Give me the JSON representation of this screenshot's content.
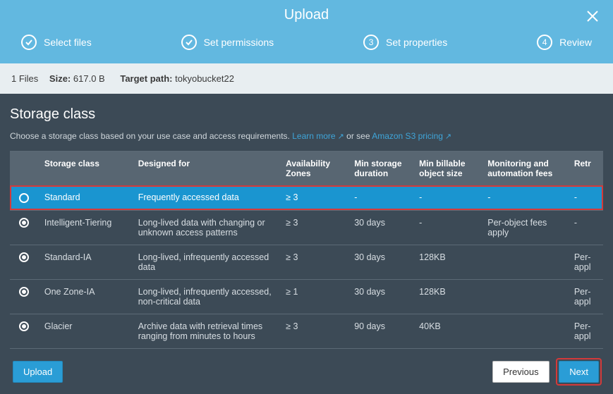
{
  "title": "Upload",
  "steps": [
    {
      "label": "Select files",
      "state": "done"
    },
    {
      "label": "Set permissions",
      "state": "done"
    },
    {
      "label": "Set properties",
      "state": "active",
      "num": "3"
    },
    {
      "label": "Review",
      "state": "todo",
      "num": "4"
    }
  ],
  "infobar": {
    "files": "1 Files",
    "size_label": "Size:",
    "size_value": "617.0 B",
    "target_label": "Target path:",
    "target_value": "tokyobucket22"
  },
  "section": {
    "title": "Storage class",
    "subtitle_pre": "Choose a storage class based on your use case and access requirements.",
    "learn_more": "Learn more",
    "or_see": "or see",
    "pricing": "Amazon S3 pricing"
  },
  "columns": {
    "name": "Storage class",
    "designed": "Designed for",
    "az": "Availability Zones",
    "duration": "Min storage duration",
    "billable": "Min billable object size",
    "monitoring": "Monitoring and automation fees",
    "retrieval": "Retr"
  },
  "rows": [
    {
      "name": "Standard",
      "designed": "Frequently accessed data",
      "az": "≥ 3",
      "duration": "-",
      "billable": "-",
      "monitoring": "-",
      "retrieval": "-",
      "selected": true
    },
    {
      "name": "Intelligent-Tiering",
      "designed": "Long-lived data with changing or unknown access patterns",
      "az": "≥ 3",
      "duration": "30 days",
      "billable": "-",
      "monitoring": "Per-object fees apply",
      "retrieval": "-"
    },
    {
      "name": "Standard-IA",
      "designed": "Long-lived, infrequently accessed data",
      "az": "≥ 3",
      "duration": "30 days",
      "billable": "128KB",
      "monitoring": "",
      "retrieval": "Per-​appl"
    },
    {
      "name": "One Zone-IA",
      "designed": "Long-lived, infrequently accessed, non-critical data",
      "az": "≥ 1",
      "duration": "30 days",
      "billable": "128KB",
      "monitoring": "",
      "retrieval": "Per-​appl"
    },
    {
      "name": "Glacier",
      "designed": "Archive data with retrieval times ranging from minutes to hours",
      "az": "≥ 3",
      "duration": "90 days",
      "billable": "40KB",
      "monitoring": "",
      "retrieval": "Per-​appl"
    }
  ],
  "buttons": {
    "upload": "Upload",
    "previous": "Previous",
    "next": "Next"
  }
}
